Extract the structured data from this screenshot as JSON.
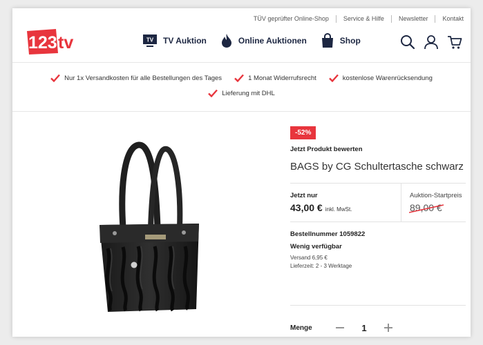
{
  "topbar": {
    "links": [
      "TÜV geprüfter Online-Shop",
      "Service & Hilfe",
      "Newsletter",
      "Kontakt"
    ]
  },
  "header": {
    "logo_text": "123tv",
    "nav": [
      {
        "label": "TV Auktion",
        "icon": "tv-icon"
      },
      {
        "label": "Online Auktionen",
        "icon": "flame-icon"
      },
      {
        "label": "Shop",
        "icon": "shopping-bag-icon"
      }
    ],
    "icons": [
      "search-icon",
      "user-icon",
      "cart-icon"
    ]
  },
  "usp": {
    "items": [
      "Nur 1x Versandkosten für alle Bestellungen des Tages",
      "1 Monat Widerrufsrecht",
      "kostenlose Warenrücksendung",
      "Lieferung mit DHL"
    ]
  },
  "product": {
    "badge": "-52%",
    "rate_link": "Jetzt Produkt bewerten",
    "title": "BAGS by CG Schultertasche schwarz",
    "price_label": "Jetzt nur",
    "price": "43,00 €",
    "price_note": "inkl. MwSt.",
    "start_label": "Auktion-Startpreis",
    "start_price": "89,00 €",
    "order_number": "Bestellnummer 1059822",
    "stock": "Wenig verfügbar",
    "shipping": "Versand 6,95 €",
    "delivery": "Lieferzeit: 2 - 3 Werktage",
    "quantity_label": "Menge",
    "quantity": "1"
  },
  "colors": {
    "brand_red": "#e8353d",
    "navy": "#1d2742"
  }
}
